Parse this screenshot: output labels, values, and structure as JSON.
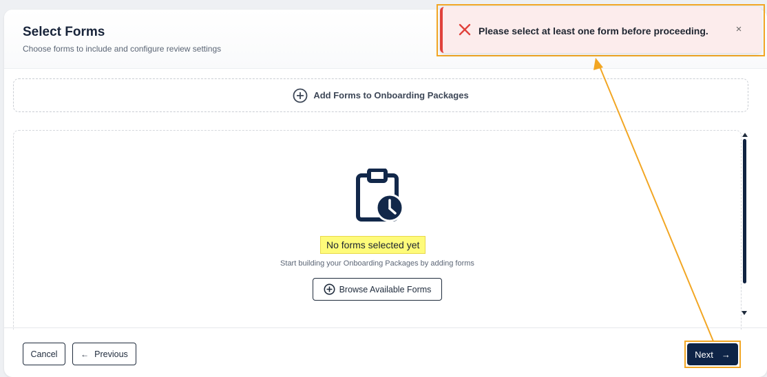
{
  "header": {
    "title": "Select Forms",
    "subtitle": "Choose forms to include and configure review settings"
  },
  "add_forms": {
    "label": "Add Forms to Onboarding Packages",
    "icon": "plus-circle-icon"
  },
  "empty_state": {
    "icon": "clipboard-clock-icon",
    "title": "No forms selected yet",
    "subtitle": "Start building your Onboarding Packages by adding forms",
    "browse_label": "Browse Available Forms"
  },
  "footer": {
    "cancel_label": "Cancel",
    "previous_label": "Previous",
    "next_label": "Next"
  },
  "toast": {
    "message": "Please select at least one form before proceeding.",
    "close_glyph": "×",
    "icon": "error-x-icon"
  },
  "colors": {
    "primary": "#0e2447",
    "error": "#e0413b",
    "toast_bg": "#fcecec",
    "highlight": "#fefb7a",
    "annotation": "#f2a623"
  }
}
